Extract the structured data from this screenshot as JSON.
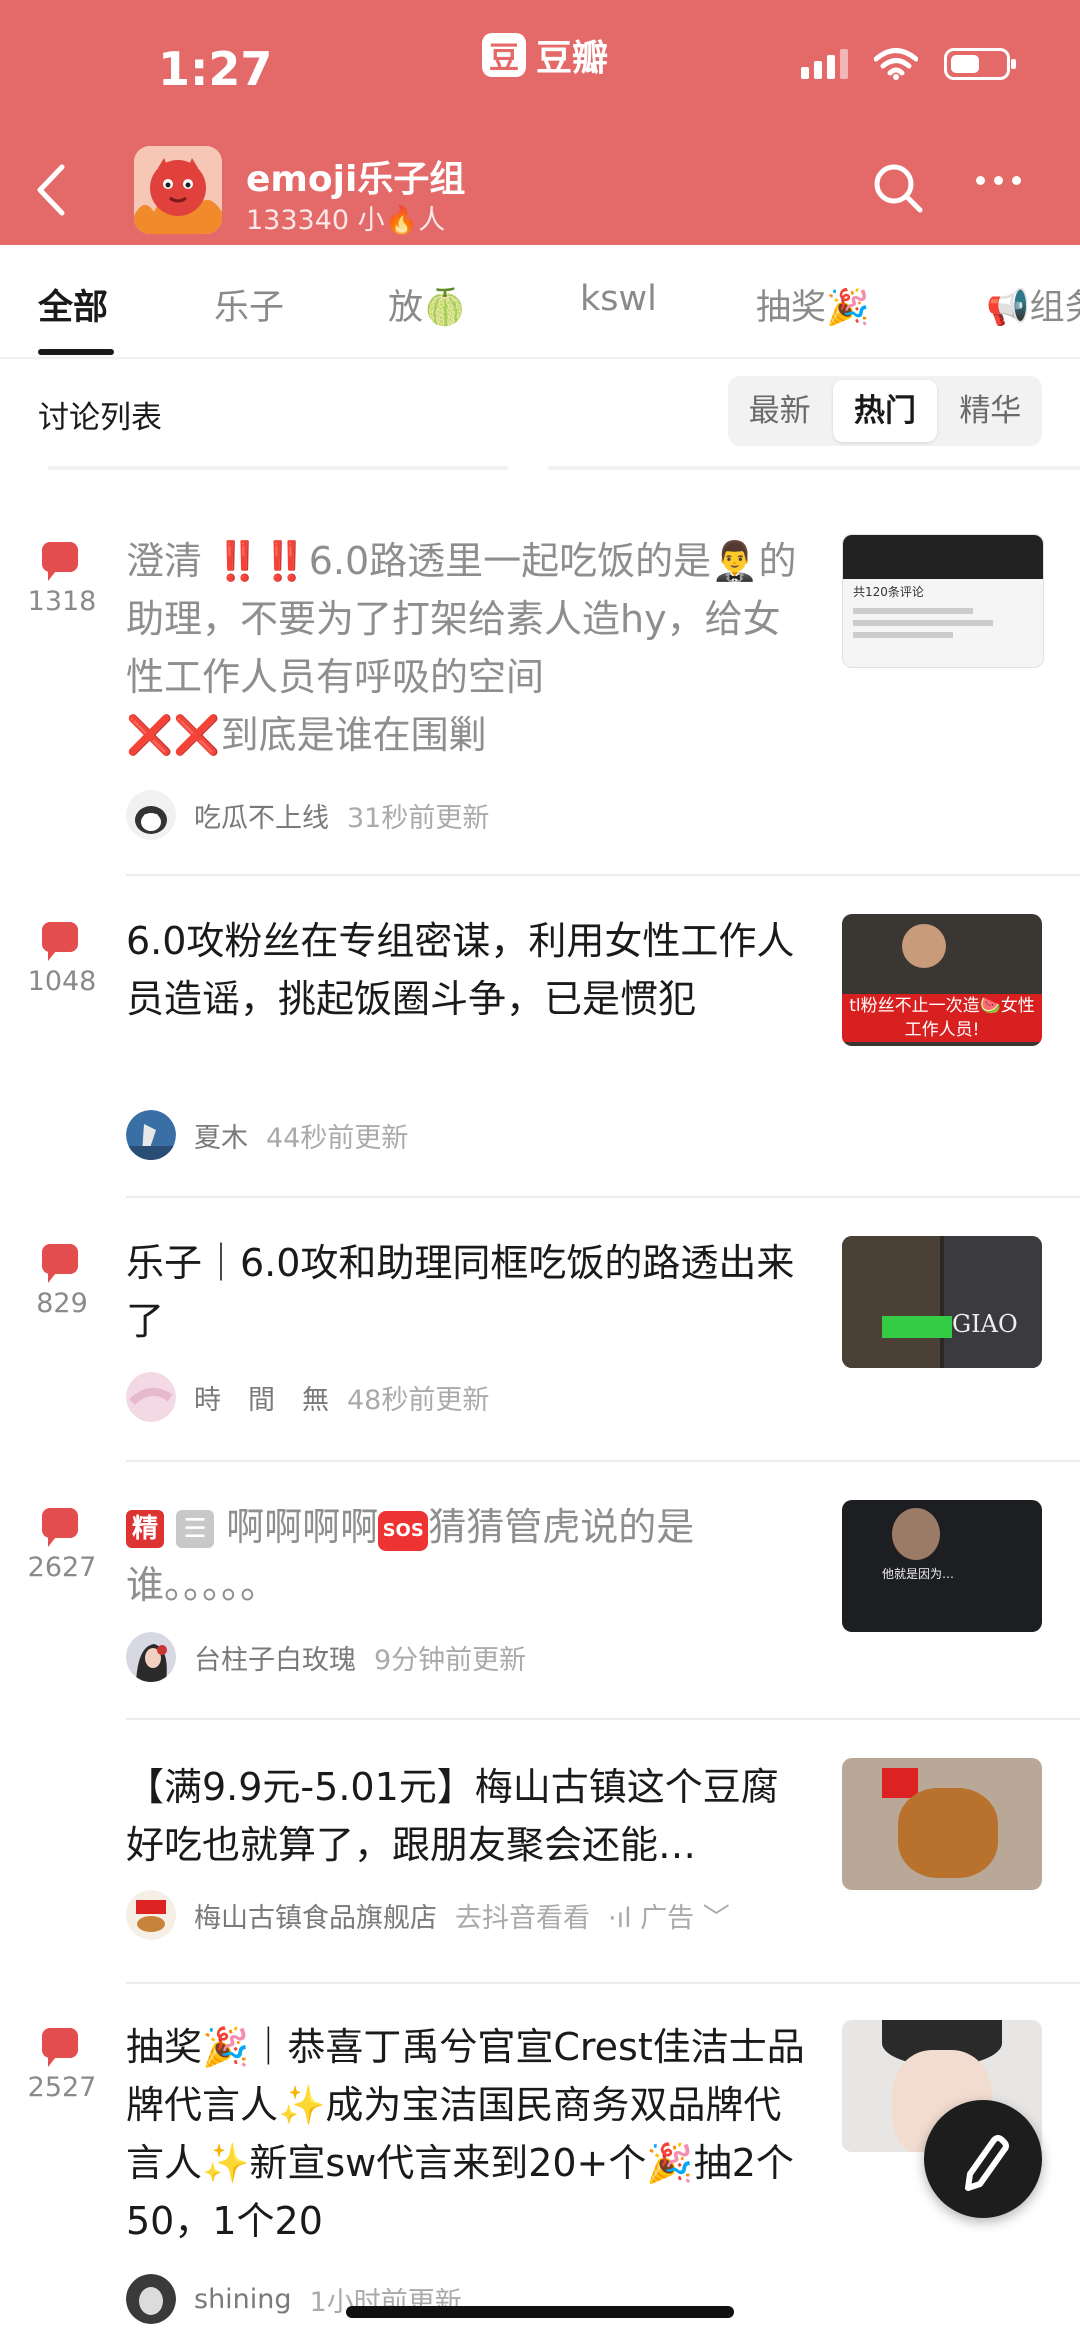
{
  "status_bar": {
    "time": "1:27",
    "brand": "豆瓣",
    "brand_logo": "豆"
  },
  "header": {
    "group_name": "emoji乐子组",
    "member_count": "133340 小🔥人",
    "back_icon": "chevron-left-icon",
    "search_icon": "search-icon",
    "more_icon": "more-icon"
  },
  "tabs": [
    {
      "label": "全部",
      "active": true
    },
    {
      "label": "乐子"
    },
    {
      "label": "放🍈"
    },
    {
      "label": "kswl"
    },
    {
      "label": "抽奖🎉"
    },
    {
      "label": "📢组务"
    }
  ],
  "list": {
    "title": "讨论列表",
    "sort_options": [
      "最新",
      "热门",
      "精华"
    ],
    "sort_selected": "热门"
  },
  "posts": [
    {
      "comments": "1318",
      "title_parts": [
        "澄清",
        "‼️‼️",
        "6.0路透里一起吃饭的是🤵‍♂️的助理，不要为了打架给素人造hy，给女性工作人员有呼吸的空间",
        "❌❌",
        "到底是谁在围剿"
      ],
      "author": "吃瓜不上线",
      "time": "31秒前更新"
    },
    {
      "comments": "1048",
      "title": "6.0攻粉丝在专组密谋，利用女性工作人员造谣，挑起饭圈斗争，已是惯犯",
      "author": "夏木",
      "time": "44秒前更新"
    },
    {
      "comments": "829",
      "title": "乐子｜6.0攻和助理同框吃饭的路透出来了",
      "author": "時　間　無",
      "time": "48秒前更新"
    },
    {
      "comments": "2627",
      "badge_jing": "精",
      "title_parts": [
        "啊啊啊啊",
        "SOS",
        "猜猜管虎说的是谁。。。。。"
      ],
      "author": "台柱子白玫瑰",
      "time": "9分钟前更新"
    },
    {
      "title": "【满9.9元-5.01元】梅山古镇这个豆腐好吃也就算了，跟朋友聚会还能…",
      "author": "梅山古镇食品旗舰店",
      "time": "去抖音看看",
      "ad_label": "广告"
    },
    {
      "comments": "2527",
      "title": "抽奖🎉｜恭喜丁禹兮官宣Crest佳洁士品牌代言人✨成为宝洁国民商务双品牌代言人✨新宣sw代言来到20+个🎉抽2个50，1个20",
      "author": "shining",
      "time": "1小时前更新"
    }
  ],
  "thumbs": {
    "post2_caption": "tl粉丝不止一次造🍉女性工作人员!",
    "post3_caption": "GIAO",
    "post1_caption": "共120条评论",
    "post4_caption": "他就是因为…"
  },
  "colors": {
    "header_bg": "#e46a6a",
    "comment_icon": "#e44d4d",
    "fab_bg": "#1d1d1d"
  },
  "fab_icon": "pencil-icon"
}
